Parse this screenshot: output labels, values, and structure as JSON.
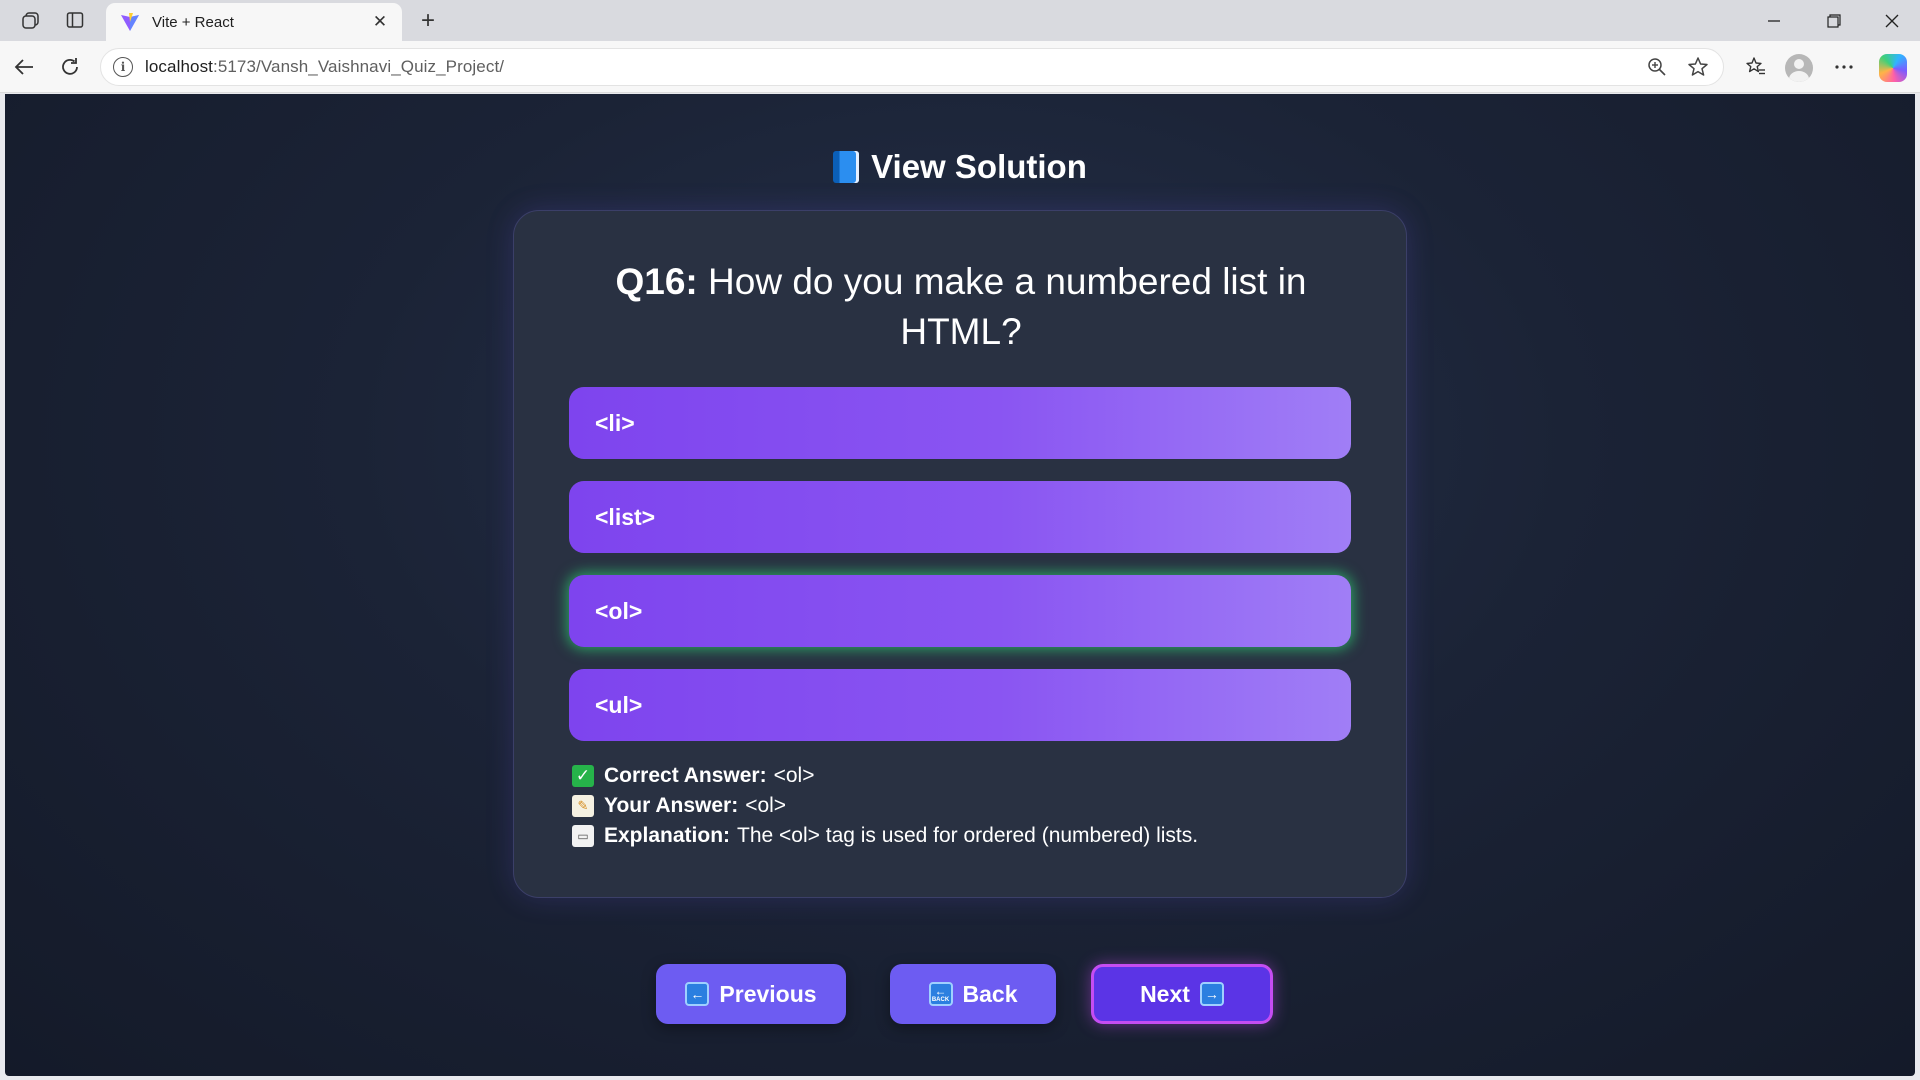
{
  "browser": {
    "tab_title": "Vite + React",
    "url_host": "localhost",
    "url_rest": ":5173/Vansh_Vaishnavi_Quiz_Project/",
    "close_tab_glyph": "✕",
    "new_tab_glyph": "+"
  },
  "page": {
    "title": "View Solution",
    "title_icon": "book-icon"
  },
  "question": {
    "number": "Q16:",
    "text": "How do you make a numbered list in HTML?"
  },
  "options": [
    {
      "label": "<li>",
      "correct": false
    },
    {
      "label": "<list>",
      "correct": false
    },
    {
      "label": "<ol>",
      "correct": true
    },
    {
      "label": "<ul>",
      "correct": false
    }
  ],
  "details": {
    "correct_label": "Correct Answer:",
    "correct_value": "<ol>",
    "your_label": "Your Answer:",
    "your_value": "<ol>",
    "explanation_label": "Explanation:",
    "explanation_value": "The <ol> tag is used for ordered (numbered) lists."
  },
  "buttons": {
    "previous": "Previous",
    "back": "Back",
    "next": "Next"
  },
  "colors": {
    "page_bg": "#1b2336",
    "card_bg": "#293142",
    "option_purple": "#8a55f2",
    "correct_glow": "#2ecc71",
    "button_blue": "#6d5cf2",
    "next_border": "#c54df2"
  }
}
